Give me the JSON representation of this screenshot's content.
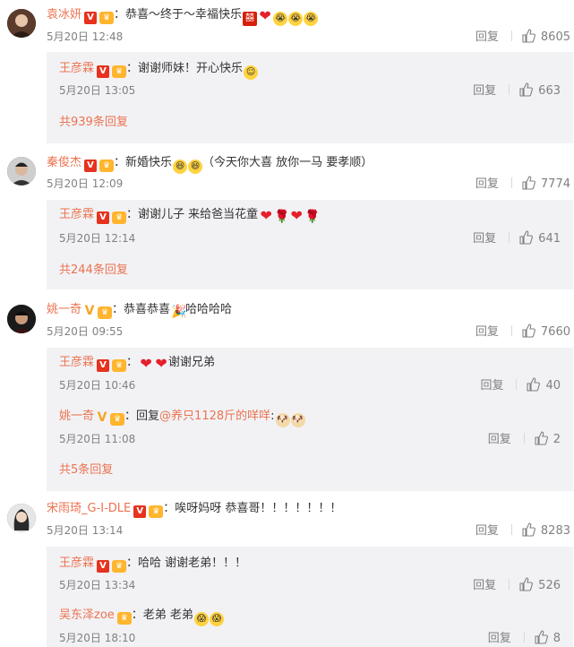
{
  "ui": {
    "reply_label": "回复",
    "colon": "："
  },
  "comments": [
    {
      "user": "袁冰妍",
      "badge": "V",
      "badge_color": "red",
      "text": "恭喜～终于～幸福快乐",
      "emojis": [
        "xi-icon",
        "heart-icon",
        "crying-face-icon",
        "crying-face-icon",
        "crying-face-icon"
      ],
      "time": "5月20日 12:48",
      "likes": "8605",
      "replies": [
        {
          "user": "王彦霖",
          "badge": "V",
          "text": "谢谢师妹！开心快乐",
          "emojis": [
            "smile-icon"
          ],
          "time": "5月20日 13:05",
          "likes": "663"
        }
      ],
      "more": "共939条回复"
    },
    {
      "user": "秦俊杰",
      "badge": "V",
      "badge_color": "red",
      "text": "新婚快乐",
      "emojis": [
        "laugh-icon",
        "laugh-icon"
      ],
      "text_after": "（今天你大喜 放你一马 要孝顺）",
      "time": "5月20日 12:09",
      "likes": "7774",
      "replies": [
        {
          "user": "王彦霖",
          "badge": "V",
          "text": "谢谢儿子 来给爸当花童",
          "emojis": [
            "heart-icon",
            "rose-icon",
            "heart-icon",
            "rose-icon"
          ],
          "time": "5月20日 12:14",
          "likes": "641"
        }
      ],
      "more": "共244条回复"
    },
    {
      "user": "姚一奇",
      "badge": "V",
      "badge_color": "gold",
      "text": "恭喜恭喜",
      "emojis": [
        "party-horn-icon"
      ],
      "text_after": "哈哈哈哈",
      "time": "5月20日 09:55",
      "likes": "7660",
      "replies": [
        {
          "user": "王彦霖",
          "badge": "V",
          "text": "",
          "emojis": [
            "heart-icon",
            "heart-icon"
          ],
          "text_after": "谢谢兄弟",
          "time": "5月20日 10:46",
          "likes": "40"
        },
        {
          "user": "姚一奇",
          "badge": "V",
          "badge_color": "gold",
          "text": "回复",
          "mention": "@养只1128斤的咩咩",
          "text_after": ":",
          "emojis": [
            "dog-icon",
            "dog-icon"
          ],
          "time": "5月20日 11:08",
          "likes": "2"
        }
      ],
      "more": "共5条回复"
    },
    {
      "user": "宋雨琦_G-I-DLE",
      "badge": "V",
      "badge_color": "red",
      "text": "唉呀妈呀 恭喜哥！！！！！！！",
      "time": "5月20日 13:14",
      "likes": "8283",
      "replies": [
        {
          "user": "王彦霖",
          "badge": "V",
          "text": "哈哈 谢谢老弟！！！",
          "emojis": [],
          "time": "5月20日 13:34",
          "likes": "526"
        },
        {
          "user": "吴东泽zoe",
          "badge": "",
          "text": "老弟 老弟",
          "emojis": [
            "scream-icon",
            "scream-icon"
          ],
          "time": "5月20日 18:10",
          "likes": "8"
        }
      ]
    }
  ],
  "colors": {
    "username": "#eb7350",
    "reply_bg": "#f2f2f5",
    "text": "#333333",
    "meta": "#808080"
  }
}
